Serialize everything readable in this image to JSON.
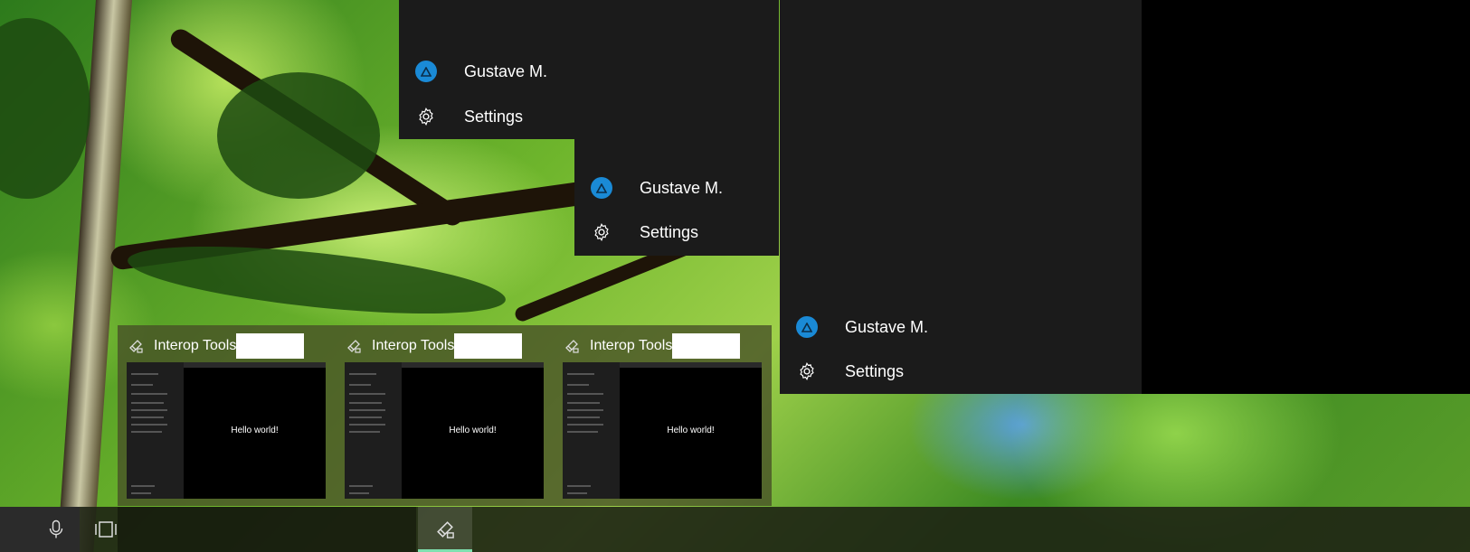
{
  "user": {
    "name": "Gustave M.",
    "avatar_color": "#1a8ad6"
  },
  "menu": {
    "settings_label": "Settings"
  },
  "previews": [
    {
      "app_title": "Interop Tools",
      "content": "Hello world!"
    },
    {
      "app_title": "Interop Tools",
      "content": "Hello world!"
    },
    {
      "app_title": "Interop Tools",
      "content": "Hello world!"
    }
  ],
  "taskbar": {
    "icons": [
      "microphone-icon",
      "task-view-icon",
      "interop-tools-app-icon"
    ],
    "active_indicator_color": "#7fe0b0"
  },
  "colors": {
    "panel_bg": "#1b1b1b",
    "accent": "#1a8ad6"
  }
}
